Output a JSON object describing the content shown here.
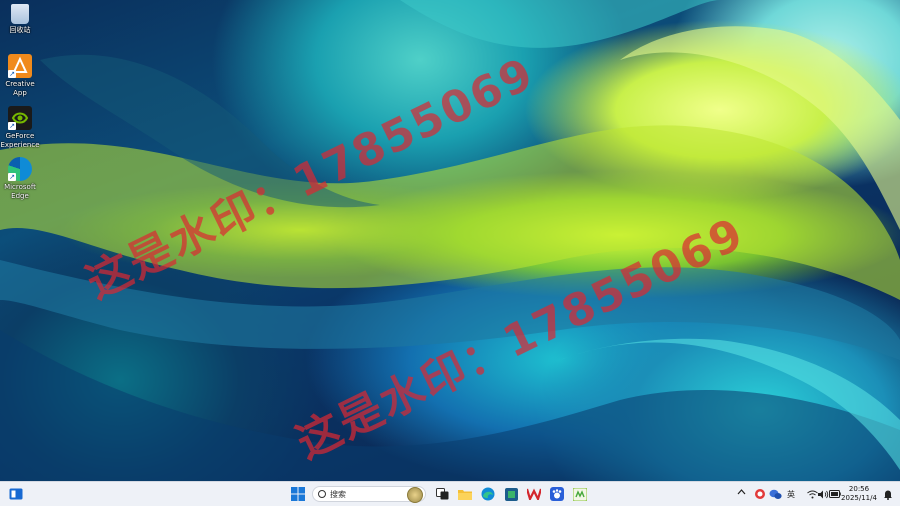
{
  "desktop": {
    "watermark_line1": "这是水印：17855069",
    "watermark_line2": "这是水印：17855069",
    "icons": [
      {
        "label": "回收站",
        "icon": "recycle-bin-icon"
      },
      {
        "label": "Creative\nApp",
        "icon": "creative-app-icon"
      },
      {
        "label": "GeForce\nExperience",
        "icon": "geforce-icon"
      },
      {
        "label": "Microsoft\nEdge",
        "icon": "edge-icon"
      }
    ]
  },
  "taskbar": {
    "search_placeholder": "搜索",
    "pinned": [
      "start-icon",
      "search-box",
      "task-view-icon",
      "file-explorer-icon",
      "edge-icon",
      "app-icon",
      "wps-icon",
      "baidu-icon",
      "app-green-icon"
    ],
    "tray": {
      "ime": "英",
      "time": "20:56",
      "date": "2025/11/4"
    }
  },
  "colors": {
    "watermark": "#dc2832",
    "taskbar_bg": "#eef1f7"
  }
}
